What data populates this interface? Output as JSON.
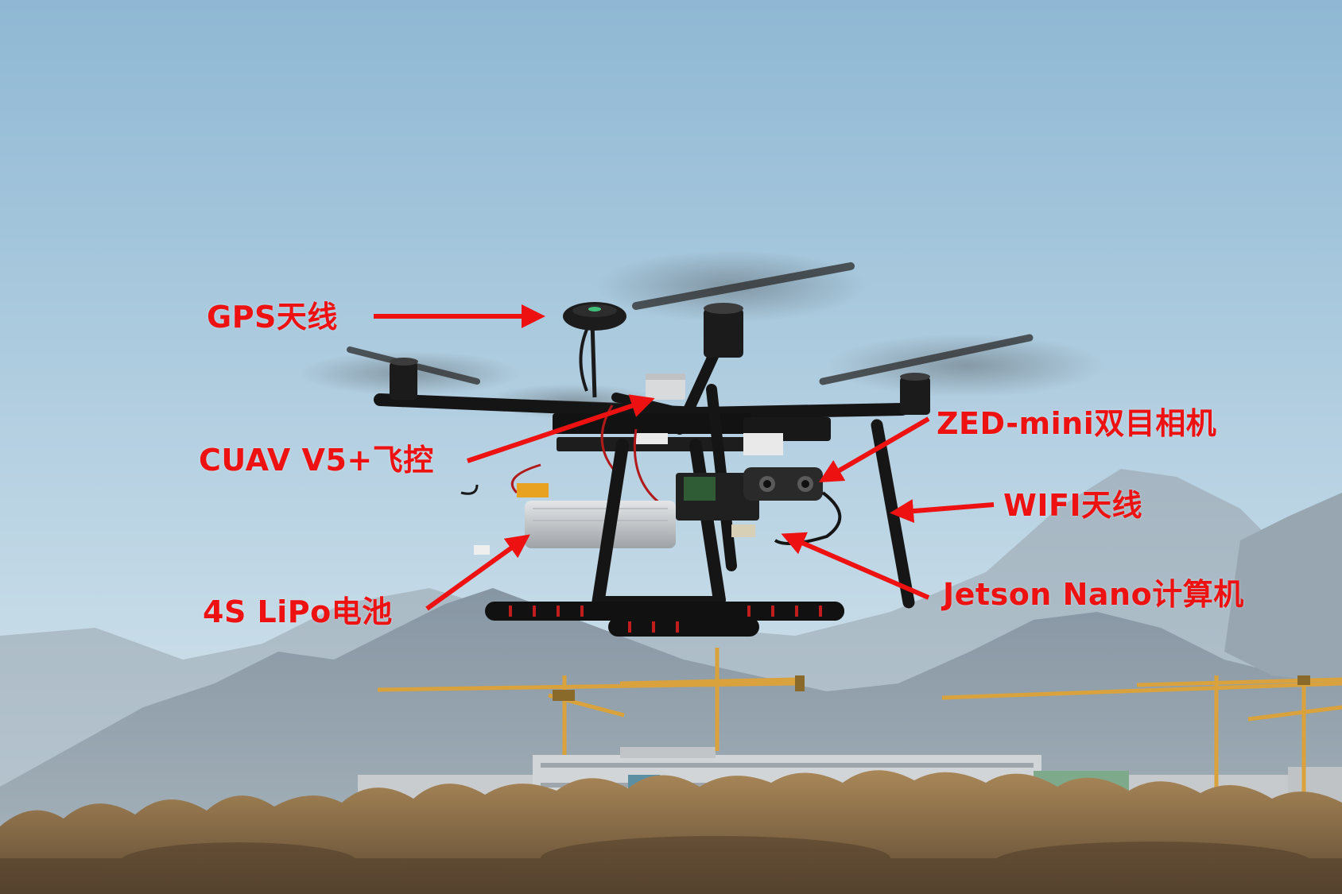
{
  "annotations": {
    "gps_antenna": "GPS天线",
    "flight_controller": "CUAV V5+飞控",
    "stereo_camera": "ZED-mini双目相机",
    "wifi_antenna": "WIFI天线",
    "battery": "4S LiPo电池",
    "compute_board": "Jetson Nano计算机"
  },
  "colors": {
    "annotation": "#ee1111",
    "sky_top": "#8fb8d4",
    "sky_bottom": "#dde9ef",
    "mountain": "#8c9fae",
    "trees": "#9a7a4a",
    "crane": "#d9a23c",
    "drone_frame": "#151515"
  }
}
